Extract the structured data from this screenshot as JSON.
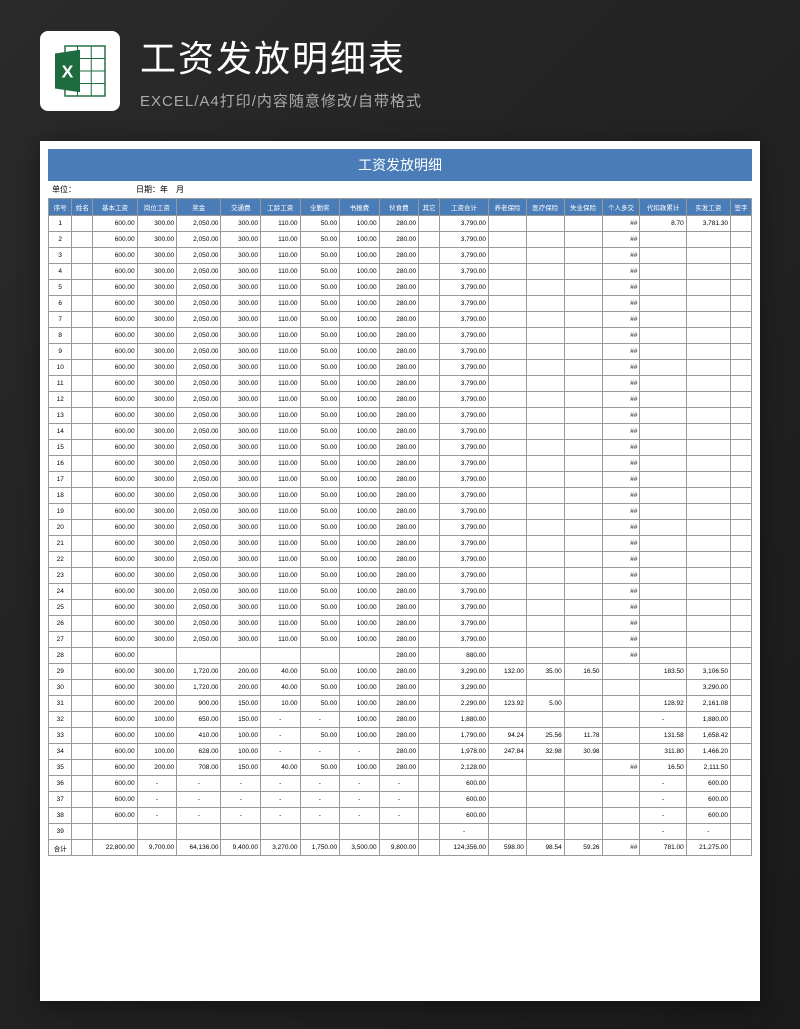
{
  "header": {
    "title": "工资发放明细表",
    "subtitle": "EXCEL/A4打印/内容随意修改/自带格式"
  },
  "sheet": {
    "title": "工资发放明细",
    "unit_label": "单位：",
    "date_label": "日期：",
    "date_value": "年　月"
  },
  "columns": [
    "序号",
    "姓名",
    "基本工资",
    "岗位工资",
    "奖金",
    "交通费",
    "工龄工资",
    "全勤奖",
    "书报费",
    "伙食费",
    "其它",
    "工资合计",
    "养老保险",
    "医疗保险",
    "失业保险",
    "个人多交",
    "代扣款累计",
    "实发工资",
    "签字"
  ],
  "rows": [
    {
      "n": "1",
      "v": [
        "",
        "600.00",
        "300.00",
        "2,050.00",
        "300.00",
        "110.00",
        "50.00",
        "100.00",
        "280.00",
        "",
        "3,790.00",
        "",
        "",
        "",
        "##",
        "8.70",
        "3,781.30",
        ""
      ]
    },
    {
      "n": "2",
      "v": [
        "",
        "600.00",
        "300.00",
        "2,050.00",
        "300.00",
        "110.00",
        "50.00",
        "100.00",
        "280.00",
        "",
        "3,790.00",
        "",
        "",
        "",
        "##",
        "",
        "",
        ""
      ]
    },
    {
      "n": "3",
      "v": [
        "",
        "600.00",
        "300.00",
        "2,050.00",
        "300.00",
        "110.00",
        "50.00",
        "100.00",
        "280.00",
        "",
        "3,790.00",
        "",
        "",
        "",
        "##",
        "",
        "",
        ""
      ]
    },
    {
      "n": "4",
      "v": [
        "",
        "600.00",
        "300.00",
        "2,050.00",
        "300.00",
        "110.00",
        "50.00",
        "100.00",
        "280.00",
        "",
        "3,790.00",
        "",
        "",
        "",
        "##",
        "",
        "",
        ""
      ]
    },
    {
      "n": "5",
      "v": [
        "",
        "600.00",
        "300.00",
        "2,050.00",
        "300.00",
        "110.00",
        "50.00",
        "100.00",
        "280.00",
        "",
        "3,790.00",
        "",
        "",
        "",
        "##",
        "",
        "",
        ""
      ]
    },
    {
      "n": "6",
      "v": [
        "",
        "600.00",
        "300.00",
        "2,050.00",
        "300.00",
        "110.00",
        "50.00",
        "100.00",
        "280.00",
        "",
        "3,790.00",
        "",
        "",
        "",
        "##",
        "",
        "",
        ""
      ]
    },
    {
      "n": "7",
      "v": [
        "",
        "600.00",
        "300.00",
        "2,050.00",
        "300.00",
        "110.00",
        "50.00",
        "100.00",
        "280.00",
        "",
        "3,790.00",
        "",
        "",
        "",
        "##",
        "",
        "",
        ""
      ]
    },
    {
      "n": "8",
      "v": [
        "",
        "600.00",
        "300.00",
        "2,050.00",
        "300.00",
        "110.00",
        "50.00",
        "100.00",
        "280.00",
        "",
        "3,790.00",
        "",
        "",
        "",
        "##",
        "",
        "",
        ""
      ]
    },
    {
      "n": "9",
      "v": [
        "",
        "600.00",
        "300.00",
        "2,050.00",
        "300.00",
        "110.00",
        "50.00",
        "100.00",
        "280.00",
        "",
        "3,790.00",
        "",
        "",
        "",
        "##",
        "",
        "",
        ""
      ]
    },
    {
      "n": "10",
      "v": [
        "",
        "600.00",
        "300.00",
        "2,050.00",
        "300.00",
        "110.00",
        "50.00",
        "100.00",
        "280.00",
        "",
        "3,790.00",
        "",
        "",
        "",
        "##",
        "",
        "",
        ""
      ]
    },
    {
      "n": "11",
      "v": [
        "",
        "600.00",
        "300.00",
        "2,050.00",
        "300.00",
        "110.00",
        "50.00",
        "100.00",
        "280.00",
        "",
        "3,790.00",
        "",
        "",
        "",
        "##",
        "",
        "",
        ""
      ]
    },
    {
      "n": "12",
      "v": [
        "",
        "600.00",
        "300.00",
        "2,050.00",
        "300.00",
        "110.00",
        "50.00",
        "100.00",
        "280.00",
        "",
        "3,790.00",
        "",
        "",
        "",
        "##",
        "",
        "",
        ""
      ]
    },
    {
      "n": "13",
      "v": [
        "",
        "600.00",
        "300.00",
        "2,050.00",
        "300.00",
        "110.00",
        "50.00",
        "100.00",
        "280.00",
        "",
        "3,790.00",
        "",
        "",
        "",
        "##",
        "",
        "",
        ""
      ]
    },
    {
      "n": "14",
      "v": [
        "",
        "600.00",
        "300.00",
        "2,050.00",
        "300.00",
        "110.00",
        "50.00",
        "100.00",
        "280.00",
        "",
        "3,790.00",
        "",
        "",
        "",
        "##",
        "",
        "",
        ""
      ]
    },
    {
      "n": "15",
      "v": [
        "",
        "600.00",
        "300.00",
        "2,050.00",
        "300.00",
        "110.00",
        "50.00",
        "100.00",
        "280.00",
        "",
        "3,790.00",
        "",
        "",
        "",
        "##",
        "",
        "",
        ""
      ]
    },
    {
      "n": "16",
      "v": [
        "",
        "600.00",
        "300.00",
        "2,050.00",
        "300.00",
        "110.00",
        "50.00",
        "100.00",
        "280.00",
        "",
        "3,790.00",
        "",
        "",
        "",
        "##",
        "",
        "",
        ""
      ]
    },
    {
      "n": "17",
      "v": [
        "",
        "600.00",
        "300.00",
        "2,050.00",
        "300.00",
        "110.00",
        "50.00",
        "100.00",
        "280.00",
        "",
        "3,790.00",
        "",
        "",
        "",
        "##",
        "",
        "",
        ""
      ]
    },
    {
      "n": "18",
      "v": [
        "",
        "600.00",
        "300.00",
        "2,050.00",
        "300.00",
        "110.00",
        "50.00",
        "100.00",
        "280.00",
        "",
        "3,790.00",
        "",
        "",
        "",
        "##",
        "",
        "",
        ""
      ]
    },
    {
      "n": "19",
      "v": [
        "",
        "600.00",
        "300.00",
        "2,050.00",
        "300.00",
        "110.00",
        "50.00",
        "100.00",
        "280.00",
        "",
        "3,790.00",
        "",
        "",
        "",
        "##",
        "",
        "",
        ""
      ]
    },
    {
      "n": "20",
      "v": [
        "",
        "600.00",
        "300.00",
        "2,050.00",
        "300.00",
        "110.00",
        "50.00",
        "100.00",
        "280.00",
        "",
        "3,790.00",
        "",
        "",
        "",
        "##",
        "",
        "",
        ""
      ]
    },
    {
      "n": "21",
      "v": [
        "",
        "600.00",
        "300.00",
        "2,050.00",
        "300.00",
        "110.00",
        "50.00",
        "100.00",
        "280.00",
        "",
        "3,790.00",
        "",
        "",
        "",
        "##",
        "",
        "",
        ""
      ]
    },
    {
      "n": "22",
      "v": [
        "",
        "600.00",
        "300.00",
        "2,050.00",
        "300.00",
        "110.00",
        "50.00",
        "100.00",
        "280.00",
        "",
        "3,790.00",
        "",
        "",
        "",
        "##",
        "",
        "",
        ""
      ]
    },
    {
      "n": "23",
      "v": [
        "",
        "600.00",
        "300.00",
        "2,050.00",
        "300.00",
        "110.00",
        "50.00",
        "100.00",
        "280.00",
        "",
        "3,790.00",
        "",
        "",
        "",
        "##",
        "",
        "",
        ""
      ]
    },
    {
      "n": "24",
      "v": [
        "",
        "600.00",
        "300.00",
        "2,050.00",
        "300.00",
        "110.00",
        "50.00",
        "100.00",
        "280.00",
        "",
        "3,790.00",
        "",
        "",
        "",
        "##",
        "",
        "",
        ""
      ]
    },
    {
      "n": "25",
      "v": [
        "",
        "600.00",
        "300.00",
        "2,050.00",
        "300.00",
        "110.00",
        "50.00",
        "100.00",
        "280.00",
        "",
        "3,790.00",
        "",
        "",
        "",
        "##",
        "",
        "",
        ""
      ]
    },
    {
      "n": "26",
      "v": [
        "",
        "600.00",
        "300.00",
        "2,050.00",
        "300.00",
        "110.00",
        "50.00",
        "100.00",
        "280.00",
        "",
        "3,790.00",
        "",
        "",
        "",
        "##",
        "",
        "",
        ""
      ]
    },
    {
      "n": "27",
      "v": [
        "",
        "600.00",
        "300.00",
        "2,050.00",
        "300.00",
        "110.00",
        "50.00",
        "100.00",
        "280.00",
        "",
        "3,790.00",
        "",
        "",
        "",
        "##",
        "",
        "",
        ""
      ]
    },
    {
      "n": "28",
      "v": [
        "",
        "600.00",
        "",
        "",
        "",
        "",
        "",
        "",
        "280.00",
        "",
        "880.00",
        "",
        "",
        "",
        "##",
        "",
        "",
        ""
      ]
    },
    {
      "n": "29",
      "v": [
        "",
        "600.00",
        "300.00",
        "1,720.00",
        "200.00",
        "40.00",
        "50.00",
        "100.00",
        "280.00",
        "",
        "3,290.00",
        "132.00",
        "35.00",
        "16.50",
        "",
        "183.50",
        "3,106.50",
        ""
      ]
    },
    {
      "n": "30",
      "v": [
        "",
        "600.00",
        "300.00",
        "1,720.00",
        "200.00",
        "40.00",
        "50.00",
        "100.00",
        "280.00",
        "",
        "3,290.00",
        "",
        "",
        "",
        "",
        "",
        "3,290.00",
        ""
      ]
    },
    {
      "n": "31",
      "v": [
        "",
        "600.00",
        "200.00",
        "900.00",
        "150.00",
        "10.00",
        "50.00",
        "100.00",
        "280.00",
        "",
        "2,290.00",
        "123.92",
        "5.00",
        "",
        "",
        "128.92",
        "2,161.08",
        ""
      ]
    },
    {
      "n": "32",
      "v": [
        "",
        "600.00",
        "100.00",
        "650.00",
        "150.00",
        "-",
        "-",
        "100.00",
        "280.00",
        "",
        "1,880.00",
        "",
        "",
        "",
        "",
        "-",
        "1,880.00",
        ""
      ]
    },
    {
      "n": "33",
      "v": [
        "",
        "600.00",
        "100.00",
        "410.00",
        "100.00",
        "-",
        "50.00",
        "100.00",
        "280.00",
        "",
        "1,790.00",
        "94.24",
        "25.56",
        "11.78",
        "",
        "131.58",
        "1,658.42",
        ""
      ]
    },
    {
      "n": "34",
      "v": [
        "",
        "600.00",
        "100.00",
        "628.00",
        "100.00",
        "-",
        "-",
        "-",
        "280.00",
        "",
        "1,978.00",
        "247.84",
        "32.98",
        "30.98",
        "",
        "311.80",
        "1,466.20",
        ""
      ]
    },
    {
      "n": "35",
      "v": [
        "",
        "600.00",
        "200.00",
        "708.00",
        "150.00",
        "40.00",
        "50.00",
        "100.00",
        "280.00",
        "",
        "2,128.00",
        "",
        "",
        "",
        "##",
        "16.50",
        "2,111.50",
        ""
      ]
    },
    {
      "n": "36",
      "v": [
        "",
        "600.00",
        "-",
        "-",
        "-",
        "-",
        "-",
        "-",
        "-",
        "",
        "600.00",
        "",
        "",
        "",
        "",
        "-",
        "600.00",
        ""
      ]
    },
    {
      "n": "37",
      "v": [
        "",
        "600.00",
        "-",
        "-",
        "-",
        "-",
        "-",
        "-",
        "-",
        "",
        "600.00",
        "",
        "",
        "",
        "",
        "-",
        "600.00",
        ""
      ]
    },
    {
      "n": "38",
      "v": [
        "",
        "600.00",
        "-",
        "-",
        "-",
        "-",
        "-",
        "-",
        "-",
        "",
        "600.00",
        "",
        "",
        "",
        "",
        "-",
        "600.00",
        ""
      ]
    },
    {
      "n": "39",
      "v": [
        "",
        "",
        "",
        "",
        "",
        "",
        "",
        "",
        "",
        "",
        "-",
        "",
        "",
        "",
        "",
        "-",
        "-",
        ""
      ]
    }
  ],
  "totals": {
    "label": "合计",
    "v": [
      "",
      "22,800.00",
      "9,700.00",
      "64,136.00",
      "9,400.00",
      "3,270.00",
      "1,750.00",
      "3,500.00",
      "9,800.00",
      "",
      "124,356.00",
      "598.00",
      "98.54",
      "59.26",
      "##",
      "781.00",
      "21,275.00",
      ""
    ]
  }
}
